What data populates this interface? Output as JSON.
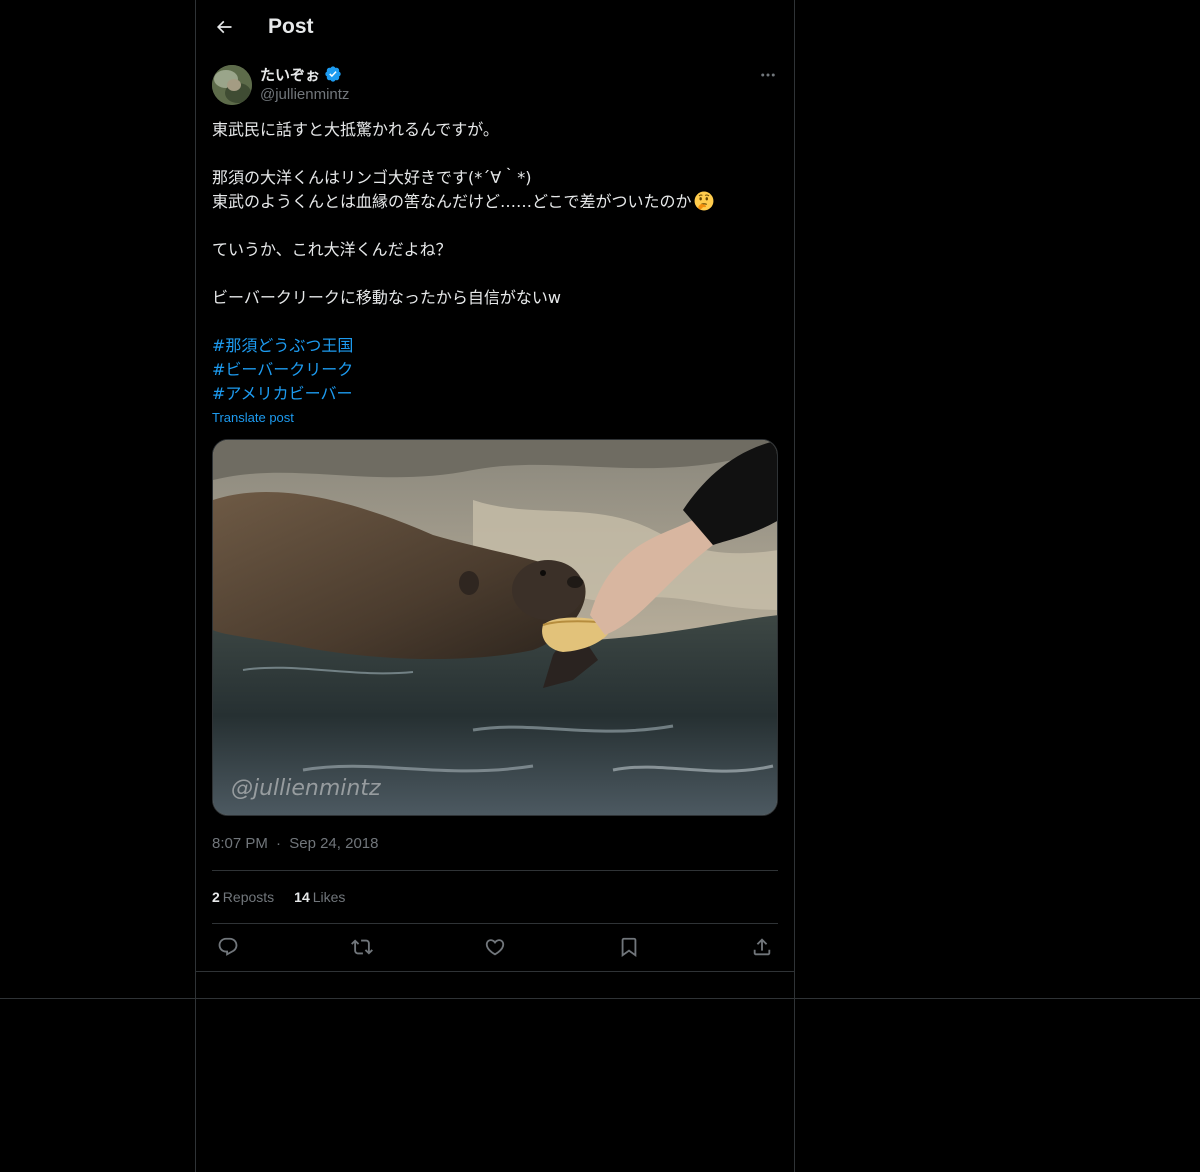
{
  "header": {
    "title": "Post"
  },
  "author": {
    "display_name": "たいぞぉ",
    "handle": "@jullienmintz",
    "verified": true
  },
  "post": {
    "lines": [
      "東武民に話すと大抵驚かれるんですが。",
      "",
      "那須の大洋くんはリンゴ大好きです(*´∀｀*)",
      "東武のようくんとは血縁の筈なんだけど……どこで差がついたのか",
      "",
      "ていうか、これ大洋くんだよね？",
      "",
      "ビーバークリークに移動なったから自信がないw",
      ""
    ],
    "thinking_emoji": "thinking-face-icon",
    "hashtags": [
      "#那須どうぶつ王国",
      "#ビーバークリーク",
      "#アメリカビーバー"
    ],
    "translate_label": "Translate post"
  },
  "media": {
    "watermark": "@jullienmintz",
    "icon": "beaver-photo"
  },
  "meta": {
    "time": "8:07 PM",
    "separator": "·",
    "date": "Sep 24, 2018"
  },
  "stats": {
    "reposts_count": "2",
    "reposts_label": "Reposts",
    "likes_count": "14",
    "likes_label": "Likes"
  },
  "actions": [
    "reply-icon",
    "repost-icon",
    "like-icon",
    "bookmark-icon",
    "share-icon"
  ],
  "colors": {
    "background": "#000000",
    "text": "#e7e9ea",
    "muted": "#71767b",
    "accent": "#1d9bf0",
    "border": "#2f3336"
  }
}
